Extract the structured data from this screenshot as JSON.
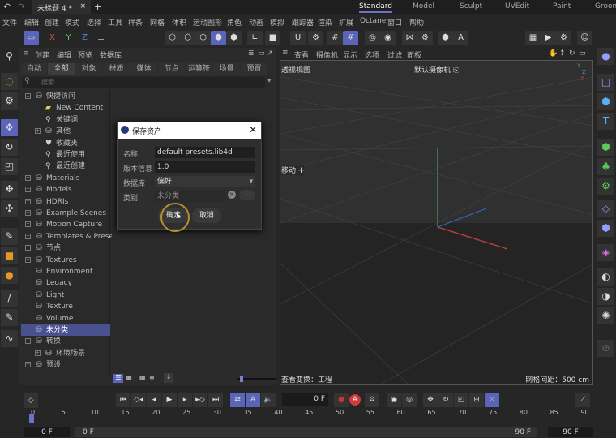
{
  "titlebar": {
    "doc_tab": "未标题 4 *",
    "close": "×",
    "new_tab": "+",
    "workspaces": [
      "Standard",
      "Model",
      "Sculpt",
      "UVEdit",
      "Paint",
      "Groom"
    ],
    "active_workspace": "Standard"
  },
  "menu": [
    "文件",
    "编辑",
    "创建",
    "模式",
    "选择",
    "工具",
    "样条",
    "网格",
    "体积",
    "运动图形",
    "角色",
    "动画",
    "模拟",
    "跟踪器",
    "渲染",
    "扩展",
    "Octane",
    "窗口",
    "帮助"
  ],
  "toolbar": {
    "axes": [
      "X",
      "Y",
      "Z"
    ]
  },
  "asset_browser": {
    "menu": [
      "创建",
      "编辑",
      "预览",
      "数据库"
    ],
    "tabs": [
      "自动",
      "全部",
      "对象",
      "材质",
      "媒体",
      "节点",
      "运算符",
      "场景",
      "预置"
    ],
    "active_tab": "全部",
    "search_placeholder": "搜索",
    "tree": [
      {
        "label": "快捷访问",
        "level": 0,
        "expand": "−",
        "icon": "database-icon"
      },
      {
        "label": "New Content",
        "level": 1,
        "icon": "folder-icon"
      },
      {
        "label": "关键词",
        "level": 1,
        "icon": "search-icon"
      },
      {
        "label": "其他",
        "level": 1,
        "expand": "+",
        "icon": "database-icon"
      },
      {
        "label": "收藏夹",
        "level": 1,
        "icon": "heart-icon"
      },
      {
        "label": "最近使用",
        "level": 1,
        "icon": "search-icon"
      },
      {
        "label": "最近创建",
        "level": 1,
        "icon": "search-icon"
      },
      {
        "label": "Materials",
        "level": 0,
        "expand": "+",
        "icon": "database-icon"
      },
      {
        "label": "Models",
        "level": 0,
        "expand": "+",
        "icon": "database-icon"
      },
      {
        "label": "HDRIs",
        "level": 0,
        "expand": "+",
        "icon": "database-icon"
      },
      {
        "label": "Example Scenes",
        "level": 0,
        "expand": "+",
        "icon": "database-icon"
      },
      {
        "label": "Motion Capture",
        "level": 0,
        "expand": "+",
        "icon": "database-icon"
      },
      {
        "label": "Templates & Presets",
        "level": 0,
        "expand": "+",
        "icon": "database-icon"
      },
      {
        "label": "节点",
        "level": 0,
        "expand": "+",
        "icon": "database-icon"
      },
      {
        "label": "Textures",
        "level": 0,
        "expand": "+",
        "icon": "database-icon"
      },
      {
        "label": "Environment",
        "level": 0,
        "icon": "database-icon"
      },
      {
        "label": "Legacy",
        "level": 0,
        "icon": "database-icon"
      },
      {
        "label": "Light",
        "level": 0,
        "icon": "database-icon"
      },
      {
        "label": "Texture",
        "level": 0,
        "icon": "database-icon"
      },
      {
        "label": "Volume",
        "level": 0,
        "icon": "database-icon"
      },
      {
        "label": "未分类",
        "level": 0,
        "icon": "database-icon",
        "selected": true
      },
      {
        "label": "转换",
        "level": 0,
        "expand": "−",
        "icon": "database-icon"
      },
      {
        "label": "环境场景",
        "level": 1,
        "expand": "+",
        "icon": "database-icon"
      },
      {
        "label": "预设",
        "level": 0,
        "expand": "+",
        "icon": "database-icon"
      }
    ]
  },
  "dialog": {
    "title": "保存资产",
    "name_label": "名称",
    "name_value": "default presets.lib4d",
    "version_label": "版本信息",
    "version_value": "1.0",
    "database_label": "数据库",
    "database_value": "偏好",
    "category_label": "类别",
    "category_value": "未分类",
    "browse": "...",
    "ok": "确定",
    "cancel": "取消"
  },
  "viewport": {
    "menu": [
      "查看",
      "摄像机",
      "显示",
      "选项",
      "过滤",
      "面板"
    ],
    "view_name": "透视视图",
    "camera": "默认摄像机",
    "tool": "移动",
    "transform": "查看变换：工程",
    "grid": "网格间距：500 cm"
  },
  "timeline": {
    "current_frame": "0 F",
    "start": "0 F",
    "start2": "0 F",
    "end": "90 F",
    "end2": "90 F",
    "ticks": [
      "0",
      "5",
      "10",
      "15",
      "20",
      "25",
      "30",
      "35",
      "40",
      "45",
      "50",
      "55",
      "60",
      "65",
      "70",
      "75",
      "80",
      "85",
      "90"
    ]
  },
  "colors": {
    "accent": "#5a64b8",
    "x_axis": "#c0433d",
    "y_axis": "#4f9a5a",
    "z_axis": "#3a68c0"
  }
}
